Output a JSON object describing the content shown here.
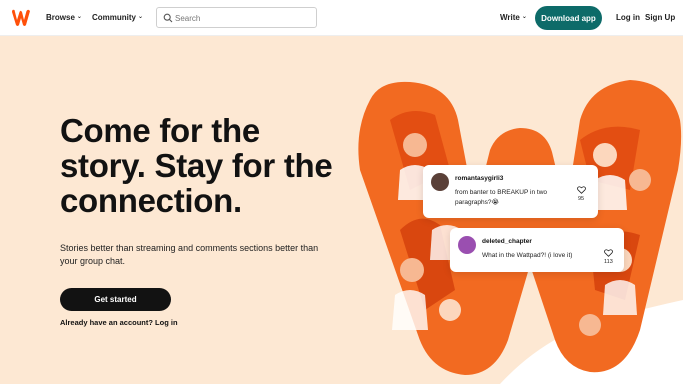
{
  "header": {
    "nav": [
      {
        "label": "Browse"
      },
      {
        "label": "Community"
      }
    ],
    "search_placeholder": "Search",
    "write_label": "Write",
    "download_label": "Download app",
    "login_label": "Log in",
    "signup_label": "Sign Up"
  },
  "hero": {
    "title": "Come for the story. Stay for the connection.",
    "subtitle": "Stories better than streaming and comments sections better than your group chat.",
    "cta_label": "Get started",
    "login_prompt": "Already have an account? Log in"
  },
  "comments": [
    {
      "username": "romantasygirli3",
      "text": "from banter to BREAKUP in two paragraphs?😭",
      "likes": "95"
    },
    {
      "username": "deleted_chapter",
      "text": "What in the Wattpad?! (i love it)",
      "likes": "113"
    }
  ],
  "colors": {
    "brand": "#ff500a",
    "accent": "#0d6b69",
    "background": "#fde8d3"
  }
}
